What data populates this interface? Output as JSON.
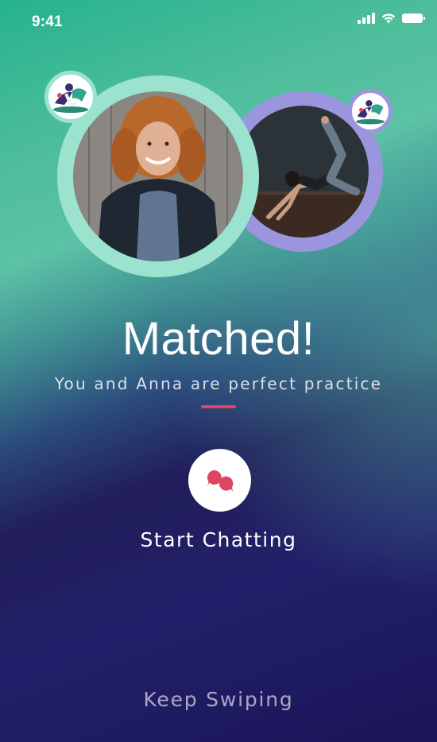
{
  "status_bar": {
    "time": "9:41",
    "icons": [
      "signal-icon",
      "wifi-icon",
      "battery-icon"
    ]
  },
  "match": {
    "left_avatar": {
      "description_icon": "woman-portrait-photo",
      "ring_color": "#9be3cf"
    },
    "right_avatar": {
      "description_icon": "yoga-pose-photo",
      "ring_color": "#9b95dd"
    },
    "badge_icon": "yoga-illustration-icon"
  },
  "title": "Matched!",
  "subtitle": "You and Anna are perfect practice",
  "accent_color": "#e04463",
  "actions": {
    "start_chatting": "Start Chatting",
    "chat_icon": "chat-bubbles-icon",
    "keep_swiping": "Keep Swiping"
  }
}
